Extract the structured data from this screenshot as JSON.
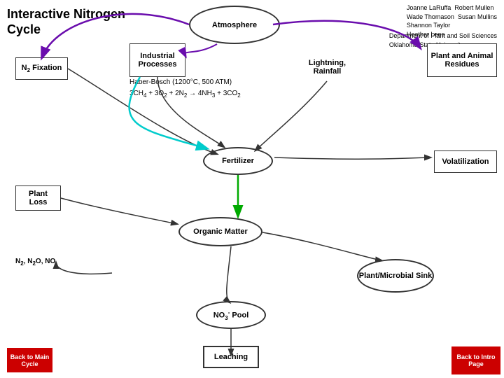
{
  "title": {
    "line1": "Interactive Nitrogen",
    "line2": "Cycle"
  },
  "credits": {
    "col1_line1": "Joanne LaRuffa",
    "col1_line2": "Wade Thomason",
    "col1_line3": "Shannon Taylor",
    "col1_line4": "Heather Lees",
    "col2_line1": "Robert Mullen",
    "col2_line2": "Susan Mullins"
  },
  "dept": {
    "line1": "Department of Plant and Soil Sciences",
    "line2": "Oklahoma State University"
  },
  "shapes": {
    "atmosphere": "Atmosphere",
    "industrial_processes": "Industrial Processes",
    "n2_fixation": "N₂ Fixation",
    "lightning_rainfall": "Lightning, Rainfall",
    "haber_bosch": "Haber-Bosch (1200°C, 500 ATM)",
    "chemical_eq": "3CH₄ + 3O₂ + 2N₂ → 4NH₃ + 3CO₂",
    "plant_animal_residues": "Plant and Animal Residues",
    "fertilizer": "Fertilizer",
    "volatilization": "Volatilization",
    "plant_loss": "Plant Loss",
    "organic_matter": "Organic Matter",
    "n2_gases": "N₂, N₂O, NO",
    "plant_microbial_sink": "Plant/Microbial Sink",
    "no3_pool": "NO₃⁻ Pool",
    "leaching": "Leaching"
  },
  "buttons": {
    "back_main": "Back to Main Cycle",
    "back_intro": "Back to Intro Page"
  }
}
